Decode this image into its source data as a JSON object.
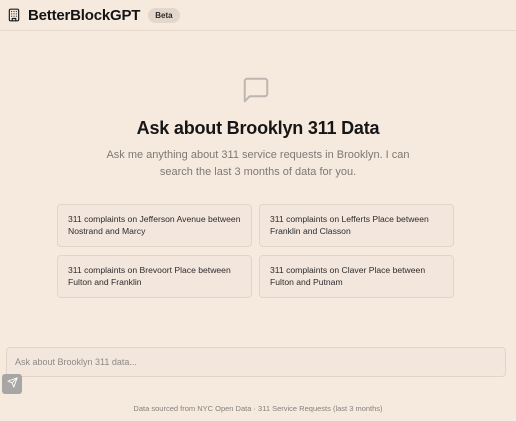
{
  "header": {
    "app_title": "BetterBlockGPT",
    "badge": "Beta",
    "logo_icon": "building-icon"
  },
  "hero": {
    "icon": "message-square-icon",
    "title": "Ask about Brooklyn 311 Data",
    "subtitle": "Ask me anything about 311 service requests in Brooklyn. I can search the last 3 months of data for you."
  },
  "suggestions": [
    "311 complaints on Jefferson Avenue between Nostrand and Marcy",
    "311 complaints on Lefferts Place between Franklin and Classon",
    "311 complaints on Brevoort Place between Fulton and Franklin",
    "311 complaints on Claver Place between Fulton and Putnam"
  ],
  "input": {
    "placeholder": "Ask about Brooklyn 311 data...",
    "value": ""
  },
  "send_button": {
    "icon": "send-icon"
  },
  "footer": {
    "text": "Data sourced from NYC Open Data · 311 Service Requests (last 3 months)"
  },
  "colors": {
    "background": "#f6eadf",
    "card": "#f3e6dd",
    "border": "#e4d4c7",
    "send_button": "#a8a6a4"
  }
}
